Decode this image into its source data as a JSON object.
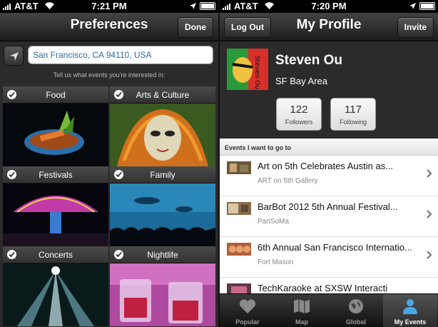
{
  "left": {
    "status": {
      "carrier": "AT&T",
      "time": "7:21 PM"
    },
    "nav": {
      "title": "Preferences",
      "done_label": "Done"
    },
    "location": {
      "value": "San Francisco, CA 94110, USA"
    },
    "hint": "Tell us what events you're interested in:",
    "categories": [
      {
        "label": "Food"
      },
      {
        "label": "Arts & Culture"
      },
      {
        "label": "Festivals"
      },
      {
        "label": "Family"
      },
      {
        "label": "Concerts"
      },
      {
        "label": "Nightlife"
      }
    ]
  },
  "right": {
    "status": {
      "carrier": "AT&T",
      "time": "7:20 PM"
    },
    "nav": {
      "title": "My Profile",
      "logout_label": "Log Out",
      "invite_label": "Invite"
    },
    "profile": {
      "name": "Steven Ou",
      "location": "SF Bay Area",
      "avatar_text": "Steven Ou",
      "followers": {
        "count": "122",
        "label": "Followers"
      },
      "following": {
        "count": "117",
        "label": "Following"
      }
    },
    "section_title": "Events I want to go to",
    "events": [
      {
        "title": "Art on 5th Celebrates Austin as...",
        "venue": "ART on 5th Gallery"
      },
      {
        "title": "BarBot 2012 5th Annual Festival...",
        "venue": "PariSoMa"
      },
      {
        "title": "6th Annual San Francisco Internatio...",
        "venue": "Fort Mason"
      },
      {
        "title": "TechKaraoke at SXSW Interacti",
        "venue": ""
      }
    ],
    "tabs": [
      {
        "label": "Popular",
        "icon": "heart-icon"
      },
      {
        "label": "Map",
        "icon": "map-icon"
      },
      {
        "label": "Global",
        "icon": "globe-icon"
      },
      {
        "label": "My Events",
        "icon": "person-icon"
      }
    ]
  }
}
